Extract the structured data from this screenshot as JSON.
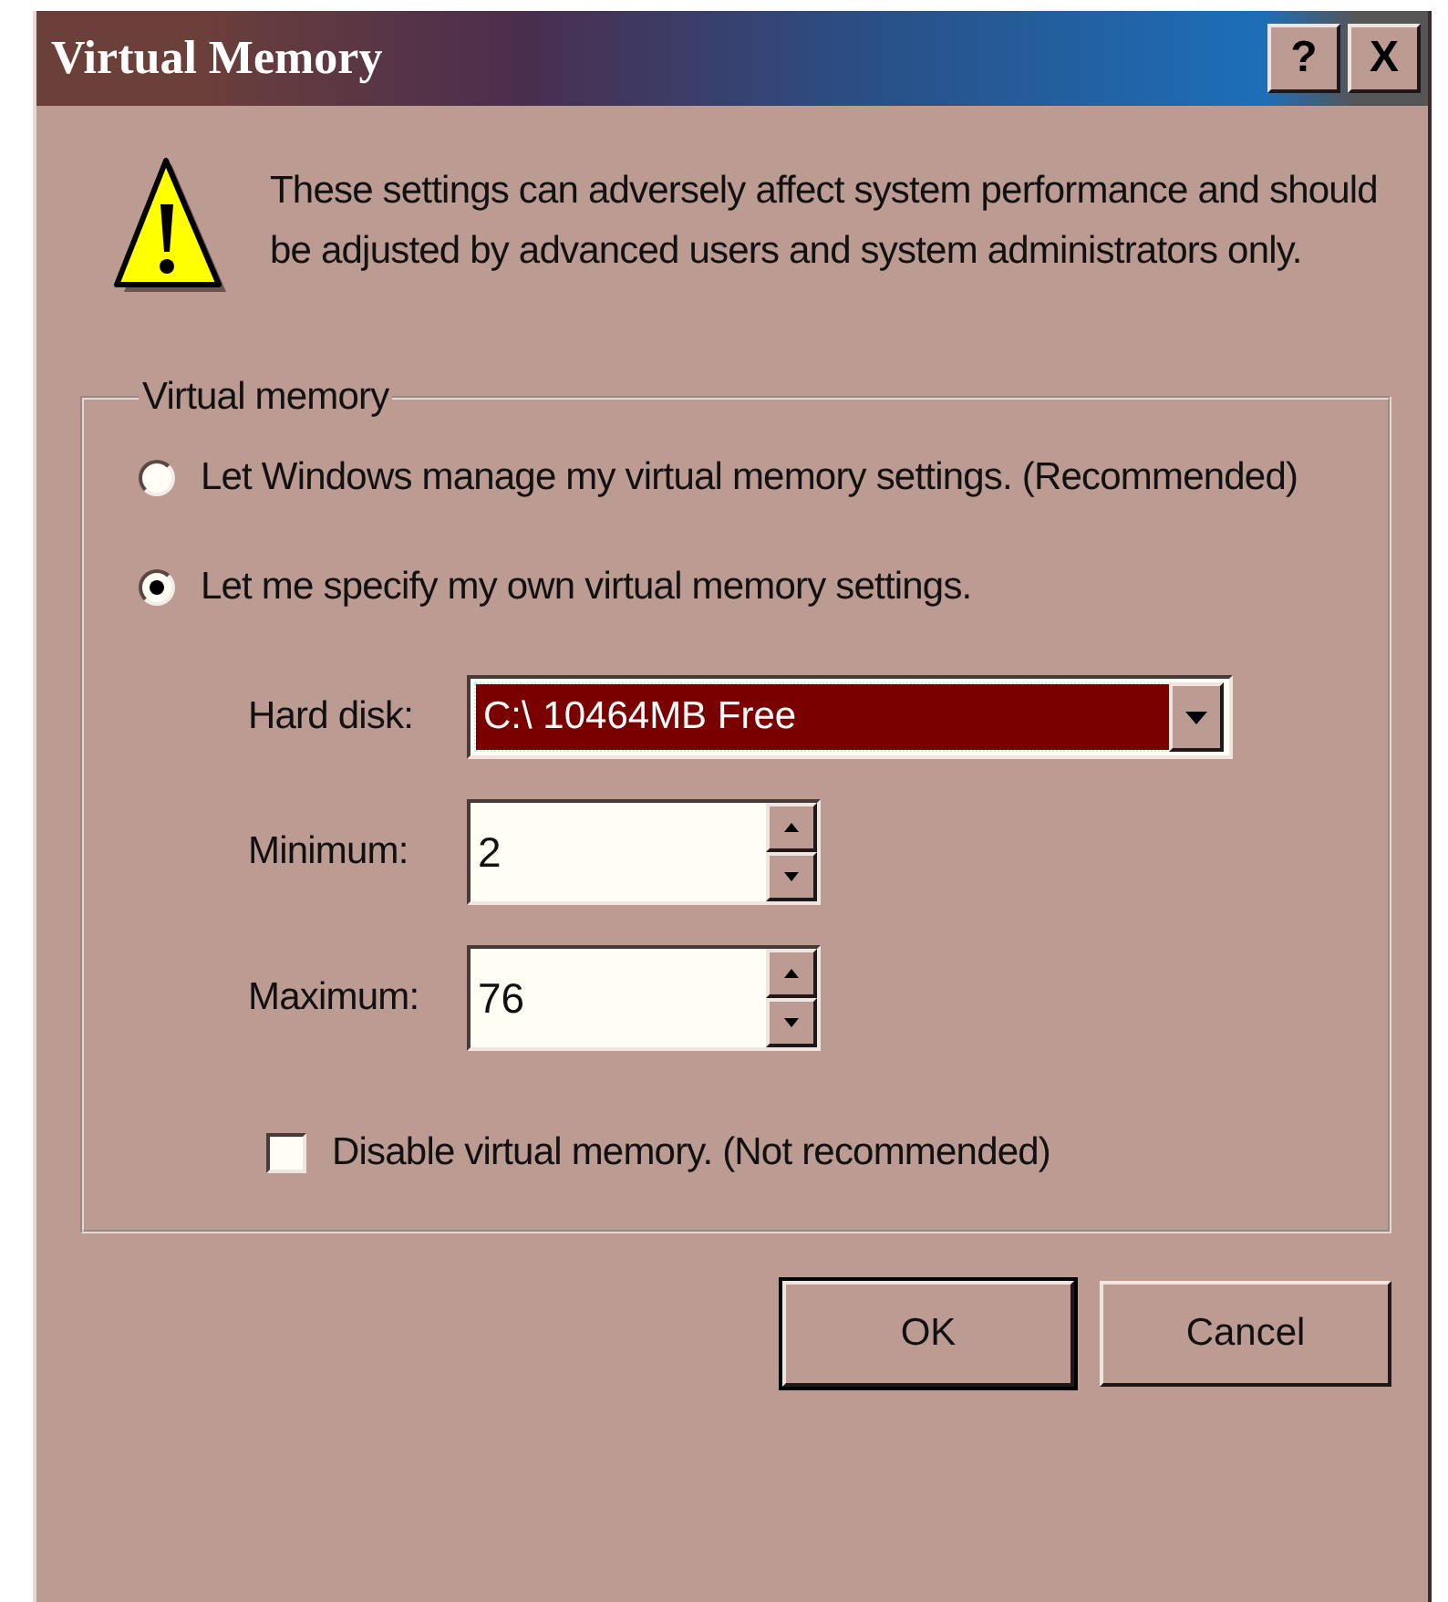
{
  "window": {
    "title": "Virtual Memory",
    "title_buttons": [
      "?",
      "X"
    ]
  },
  "warning": {
    "text": "These settings can adversely affect system performance and should be adjusted by advanced users and system administrators only."
  },
  "group": {
    "label": "Virtual memory",
    "options": [
      {
        "label": "Let Windows manage my virtual memory settings. (Recommended)",
        "selected": false
      },
      {
        "label": "Let me specify my own virtual memory settings.",
        "selected": true
      }
    ],
    "hard_disk": {
      "label": "Hard disk:",
      "value": "C:\\ 10464MB Free"
    },
    "fields": [
      {
        "label": "Minimum:",
        "value": "2"
      },
      {
        "label": "Maximum:",
        "value": "76"
      }
    ],
    "disable": {
      "label": "Disable virtual memory. (Not recommended)",
      "checked": false
    }
  },
  "buttons": [
    {
      "label": "OK",
      "default": true
    },
    {
      "label": "Cancel",
      "default": false
    }
  ]
}
